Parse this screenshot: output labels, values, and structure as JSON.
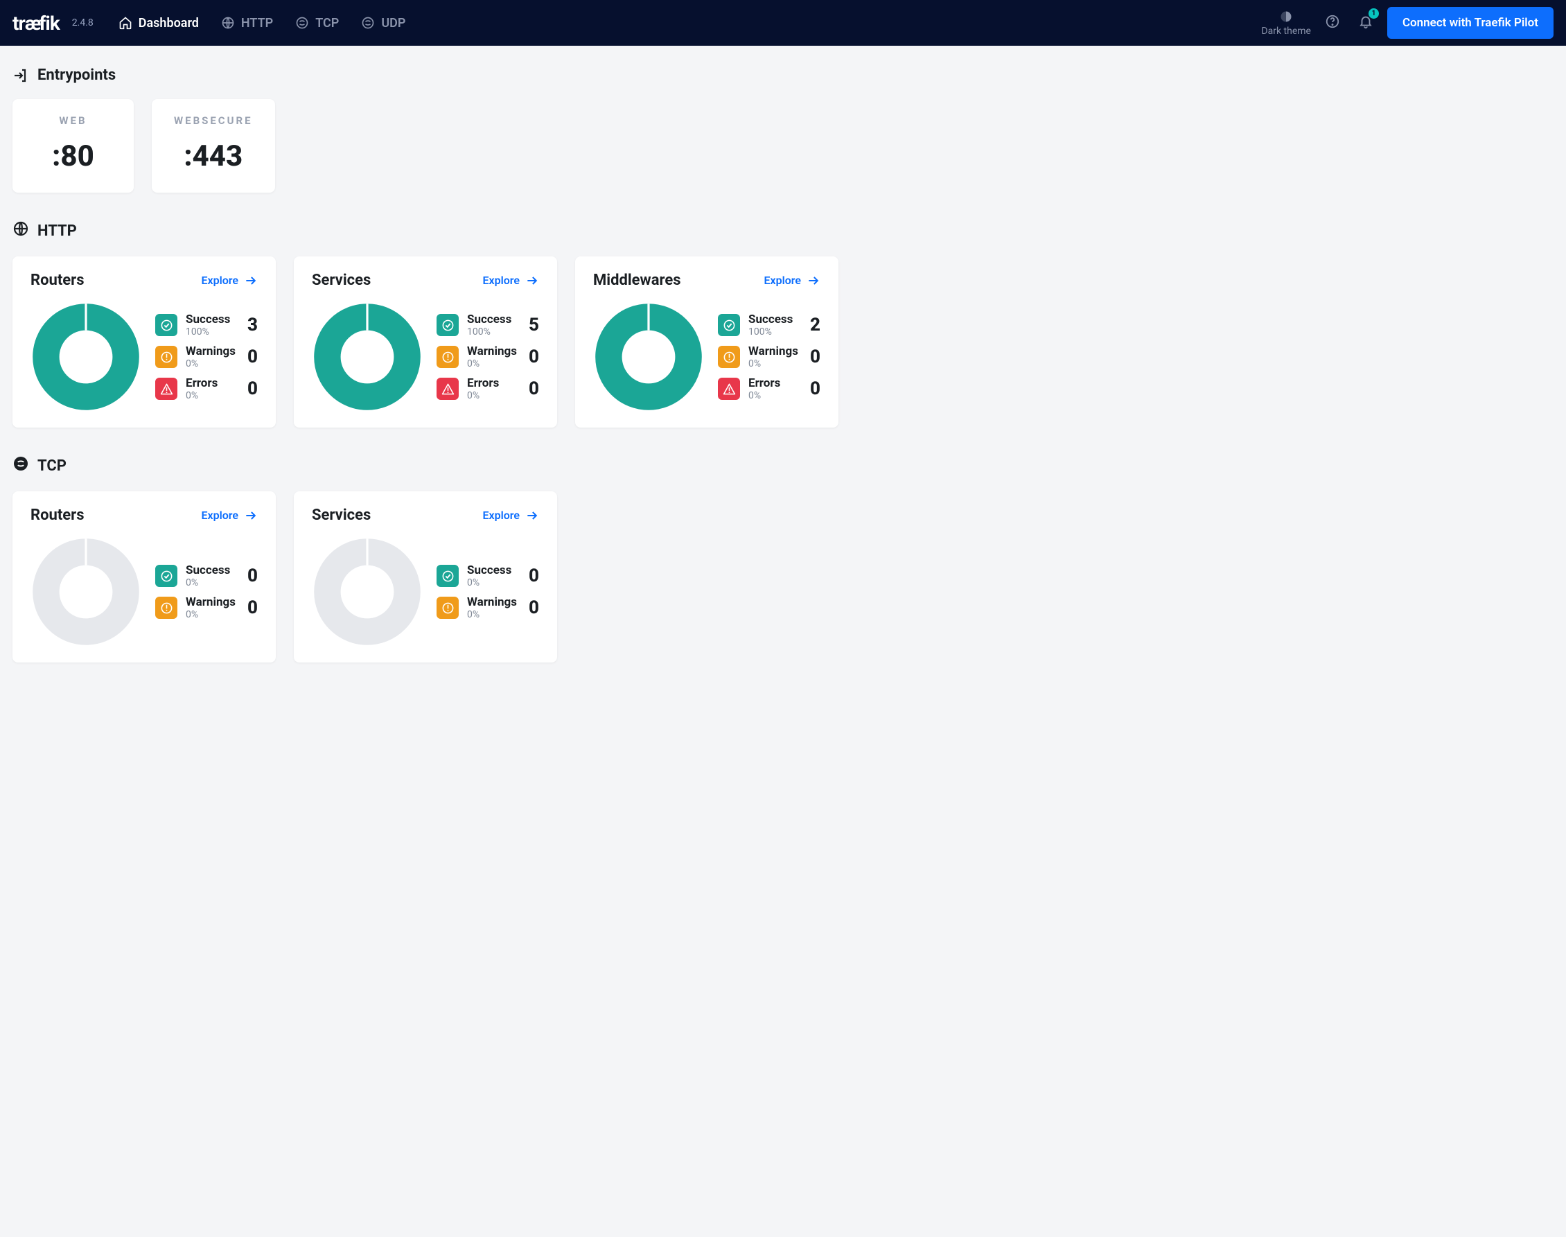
{
  "header": {
    "brand": "træfik",
    "version": "2.4.8",
    "nav": [
      {
        "label": "Dashboard",
        "active": true
      },
      {
        "label": "HTTP",
        "active": false
      },
      {
        "label": "TCP",
        "active": false
      },
      {
        "label": "UDP",
        "active": false
      }
    ],
    "theme_toggle": "Dark theme",
    "notification_badge": "1",
    "pilot_button": "Connect with Traefik Pilot"
  },
  "entrypoints": {
    "title": "Entrypoints",
    "items": [
      {
        "name": "WEB",
        "port": ":80"
      },
      {
        "name": "WEBSECURE",
        "port": ":443"
      }
    ]
  },
  "sections": [
    {
      "title": "HTTP",
      "cards": [
        {
          "title": "Routers",
          "explore": "Explore",
          "success_pct": "100%",
          "warn_pct": "0%",
          "err_pct": "0%",
          "success_n": "3",
          "warn_n": "0",
          "err_n": "0",
          "donut": "full"
        },
        {
          "title": "Services",
          "explore": "Explore",
          "success_pct": "100%",
          "warn_pct": "0%",
          "err_pct": "0%",
          "success_n": "5",
          "warn_n": "0",
          "err_n": "0",
          "donut": "full"
        },
        {
          "title": "Middlewares",
          "explore": "Explore",
          "success_pct": "100%",
          "warn_pct": "0%",
          "err_pct": "0%",
          "success_n": "2",
          "warn_n": "0",
          "err_n": "0",
          "donut": "full"
        }
      ]
    },
    {
      "title": "TCP",
      "cards": [
        {
          "title": "Routers",
          "explore": "Explore",
          "success_pct": "0%",
          "warn_pct": "0%",
          "success_n": "0",
          "warn_n": "0",
          "donut": "empty"
        },
        {
          "title": "Services",
          "explore": "Explore",
          "success_pct": "0%",
          "warn_pct": "0%",
          "success_n": "0",
          "warn_n": "0",
          "donut": "empty"
        }
      ]
    }
  ],
  "labels": {
    "success": "Success",
    "warnings": "Warnings",
    "errors": "Errors"
  },
  "colors": {
    "success": "#1ba696",
    "warn": "#f09b1a",
    "err": "#e8374a",
    "accent": "#0d6efd",
    "empty": "#e6e8ec"
  },
  "chart_data": [
    {
      "type": "pie",
      "title": "HTTP Routers",
      "series": [
        {
          "name": "Success",
          "value": 3
        },
        {
          "name": "Warnings",
          "value": 0
        },
        {
          "name": "Errors",
          "value": 0
        }
      ]
    },
    {
      "type": "pie",
      "title": "HTTP Services",
      "series": [
        {
          "name": "Success",
          "value": 5
        },
        {
          "name": "Warnings",
          "value": 0
        },
        {
          "name": "Errors",
          "value": 0
        }
      ]
    },
    {
      "type": "pie",
      "title": "HTTP Middlewares",
      "series": [
        {
          "name": "Success",
          "value": 2
        },
        {
          "name": "Warnings",
          "value": 0
        },
        {
          "name": "Errors",
          "value": 0
        }
      ]
    },
    {
      "type": "pie",
      "title": "TCP Routers",
      "series": [
        {
          "name": "Success",
          "value": 0
        },
        {
          "name": "Warnings",
          "value": 0
        }
      ]
    },
    {
      "type": "pie",
      "title": "TCP Services",
      "series": [
        {
          "name": "Success",
          "value": 0
        },
        {
          "name": "Warnings",
          "value": 0
        }
      ]
    }
  ]
}
